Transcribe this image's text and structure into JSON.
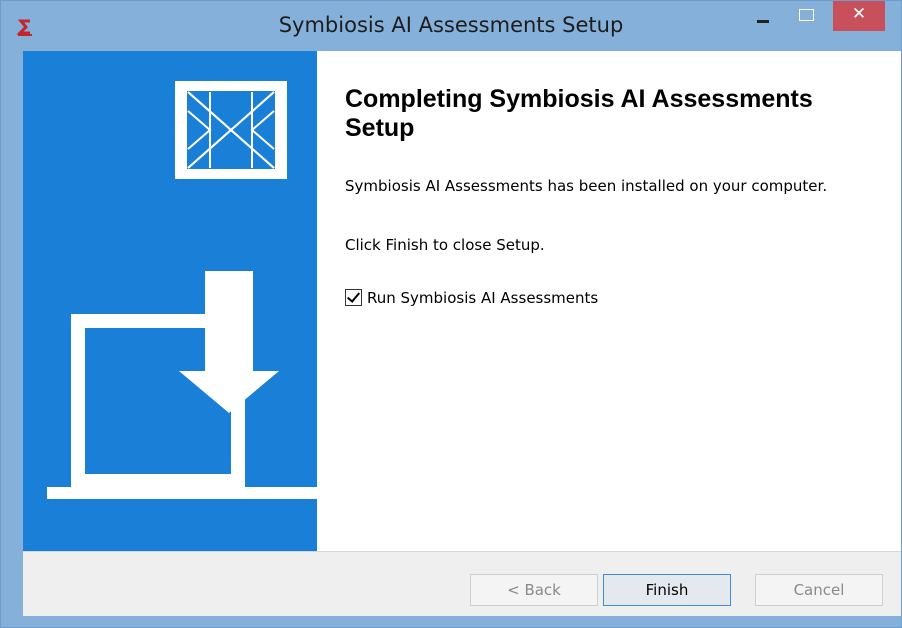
{
  "window": {
    "title": "Symbiosis AI Assessments Setup",
    "close_symbol": "✕",
    "controls": [
      "minimize-icon",
      "maximize-icon",
      "close-icon"
    ]
  },
  "banner": {
    "background_color": "#1a7fd6",
    "icons": [
      "product-logo-icon",
      "download-to-laptop-icon"
    ]
  },
  "content": {
    "heading": "Completing Symbiosis AI Assessments Setup",
    "message": "Symbiosis AI Assessments has been installed on your computer.",
    "instruction": "Click Finish to close Setup.",
    "run_checkbox": {
      "label": "Run Symbiosis AI Assessments",
      "checked": true
    }
  },
  "buttons": {
    "back": "< Back",
    "finish": "Finish",
    "cancel": "Cancel"
  }
}
